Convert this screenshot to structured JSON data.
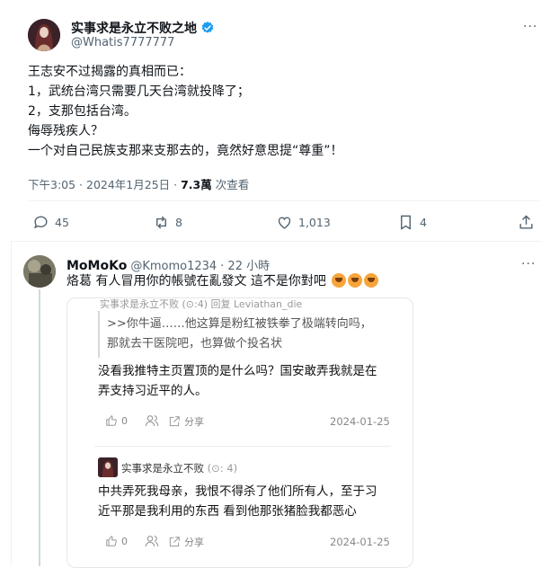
{
  "colors": {
    "verified": "#1d9bf0",
    "muted": "#536471",
    "divider": "#eff3f4"
  },
  "main_tweet": {
    "display_name": "实事求是永立不败之地",
    "handle": "@Whatis7777777",
    "more": "···",
    "lines": [
      "王志安不过揭露的真相而已：",
      "1，武统台湾只需要几天台湾就投降了；",
      "2，支那包括台湾。",
      "侮辱残疾人？",
      "一个对自己民族支那来支那去的，竟然好意思提“尊重”！"
    ],
    "time": "下午3:05 · 2024年1月25日 · ",
    "views_count": "7.3萬",
    "views_label": " 次查看",
    "actions": {
      "replies": "45",
      "reposts": "8",
      "likes": "1,013",
      "bookmarks": "4"
    }
  },
  "reply": {
    "display_name": "MoMoKo",
    "handle": "@Kmomo1234",
    "time": " · 22 小時",
    "more": "···",
    "text": "烙葛  有人冒用你的帳號在亂發文 這不是你對吧",
    "emojis": [
      "tired-face-emoji",
      "tired-face-emoji",
      "tired-face-emoji"
    ]
  },
  "screenshot": {
    "top_cut": "实事求是永立不败 (⊙:4) 回复 Leviathan_die",
    "quote": ">>你牛逼……他这算是粉红被铁拳了极端转向吗，那就去干医院吧，也算做个投名状",
    "comment1": "没看我推特主页置顶的是什么吗？国安敢弄我就是在弄支持习近平的人。",
    "comment1_like": "0",
    "share_label": "分享",
    "date1": "2024-01-25",
    "user2": "实事求是永立不败",
    "badge2": "(⊙: 4)",
    "comment2": "中共弄死我母亲，我恨不得杀了他们所有人，至于习近平那是我利用的东西 看到他那张猪脸我都恶心",
    "comment2_like": "0",
    "date2": "2024-01-25"
  }
}
